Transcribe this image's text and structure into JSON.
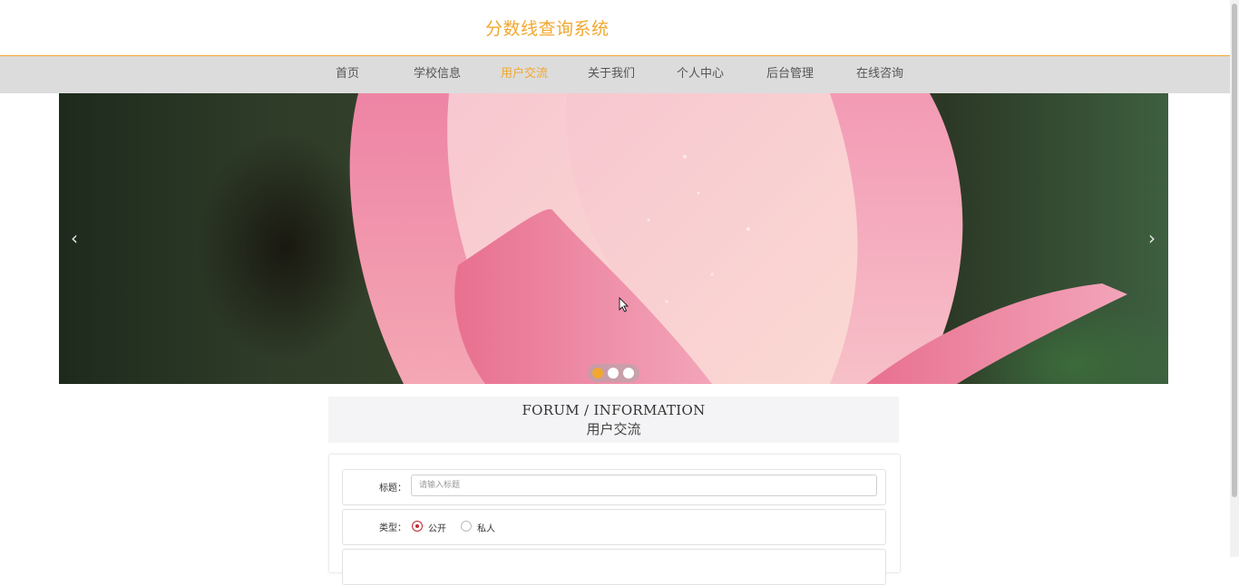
{
  "header": {
    "title": "分数线查询系统"
  },
  "nav": {
    "items": [
      {
        "label": "首页"
      },
      {
        "label": "学校信息"
      },
      {
        "label": "用户交流"
      },
      {
        "label": "关于我们"
      },
      {
        "label": "个人中心"
      },
      {
        "label": "后台管理"
      },
      {
        "label": "在线咨询"
      }
    ],
    "active_index": 2
  },
  "carousel": {
    "prev_icon": "chevron-left-icon",
    "next_icon": "chevron-right-icon",
    "slides": 3,
    "active_slide": 1
  },
  "section": {
    "title_en": "FORUM / INFORMATION",
    "title_cn": "用户交流"
  },
  "form": {
    "title_label": "标题：",
    "title_placeholder": "请输入标题",
    "type_label": "类型：",
    "type_options": [
      {
        "label": "公开",
        "checked": true
      },
      {
        "label": "私人",
        "checked": false
      }
    ]
  },
  "colors": {
    "accent": "#f0a830",
    "nav_bg": "#dcdcdc",
    "radio_checked": "#c0282d"
  }
}
